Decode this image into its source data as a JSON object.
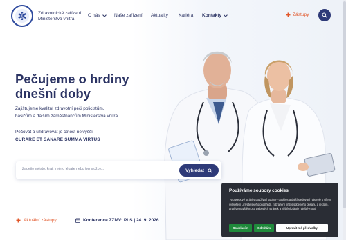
{
  "header": {
    "org_name_line1": "Zdravotnické zařízení",
    "org_name_line2": "Ministerstva vnitra",
    "nav": [
      "O nás",
      "Naše zařízení",
      "Aktuality",
      "Kariéra",
      "Kontakty"
    ],
    "zastupy_label": "Zástupy",
    "logo_icon": "logo-star-of-life-icon"
  },
  "hero": {
    "title_line1": "Pečujeme o hrdiny",
    "title_line2": "dnešní doby",
    "text_line1": "Zajišťujeme kvalitní zdravotní péči policistům,",
    "text_line2": "hasičům a dalším zaměstnancům Ministerstva vnitra.",
    "text2": "Pečovat a uzdravovat je ctnost nejvyšší",
    "motto": "CURARE ET SANARE SUMMA VIRTUS"
  },
  "search": {
    "placeholder": "Zadejte město, kraj, jméno lékaře nebo typ služby...",
    "button_label": "Vyhledat"
  },
  "links": {
    "current_zastupy": "Aktuální zástupy",
    "conference": "Konference ZZMV: PLS | 24. 9. 2026"
  },
  "cookie": {
    "title": "Používáme soubory cookies",
    "text": "Tyto webové stránky používají soubory cookies a další sledovací nástroje s cílem vylepšení uživatelského prostředí, zobrazení přizpůsobeného obsahu a reklam, analýzy návštěvnosti webových stránek a zjištění zdroje návštěvnosti.",
    "btn_accept": "Souhlasím",
    "btn_reject": "Odmítám",
    "btn_settings": "Upravit mé předvolby"
  },
  "colors": {
    "navy": "#2b3363",
    "button": "#2e3a78",
    "accent": "#e2572a",
    "cookie_bg": "#2a2d35",
    "cookie_green": "#1f8a3b"
  }
}
